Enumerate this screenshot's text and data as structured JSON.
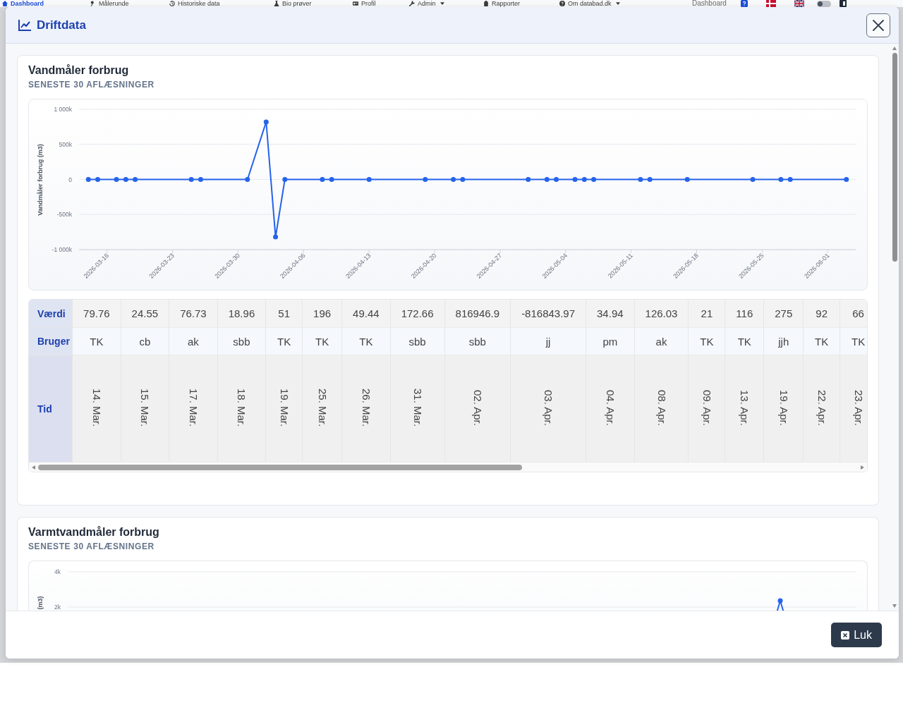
{
  "background_nav": {
    "items": [
      {
        "label": "Dashboard",
        "selected": true,
        "has_menu": false
      },
      {
        "label": "Målerunde",
        "selected": false,
        "has_menu": false
      },
      {
        "label": "Historiske data",
        "selected": false,
        "has_menu": false
      },
      {
        "label": "Bio prøver",
        "selected": false,
        "has_menu": false
      },
      {
        "label": "Profil",
        "selected": false,
        "has_menu": false
      },
      {
        "label": "Admin",
        "selected": false,
        "has_menu": true
      },
      {
        "label": "Rapporter",
        "selected": false,
        "has_menu": false
      },
      {
        "label": "Om databad.dk",
        "selected": false,
        "has_menu": true
      }
    ],
    "page_title": "Dashboard",
    "theme_switch": {
      "on": false
    }
  },
  "dialog": {
    "title": "Driftdata",
    "sections": [
      {
        "title": "Vandmåler forbrug",
        "subtitle": "SENESTE 30 AFLÆSNINGER",
        "chart_data": {
          "type": "line",
          "ylabel": "Vandmåler forbrug (m3)",
          "x": [
            "2026-03-14",
            "2026-03-15",
            "2026-03-17",
            "2026-03-18",
            "2026-03-19",
            "2026-03-25",
            "2026-03-26",
            "2026-03-31",
            "2026-04-02",
            "2026-04-03",
            "2026-04-04",
            "2026-04-08",
            "2026-04-09",
            "2026-04-13",
            "2026-04-19",
            "2026-04-22",
            "2026-04-23",
            "2026-04-30",
            "2026-05-02",
            "2026-05-03",
            "2026-05-05",
            "2026-05-06",
            "2026-05-07",
            "2026-05-12",
            "2026-05-13",
            "2026-05-17",
            "2026-05-24",
            "2026-05-27",
            "2026-05-28",
            "2026-06-03"
          ],
          "series": [
            {
              "color": "#2563eb",
              "marker": true,
              "values": [
                0,
                0,
                0,
                0,
                0,
                0,
                0,
                0,
                820000,
                -820000,
                0,
                0,
                0,
                0,
                0,
                0,
                0,
                0,
                0,
                0,
                0,
                0,
                0,
                0,
                0,
                0,
                0,
                0,
                0,
                0
              ]
            }
          ],
          "xlim": [
            "2026-03-13",
            "2026-06-04"
          ],
          "ylim": [
            -1000000,
            1000000
          ],
          "xticks": [
            "2026-03-16",
            "2026-03-23",
            "2026-03-30",
            "2026-04-06",
            "2026-04-13",
            "2026-04-20",
            "2026-04-27",
            "2026-05-04",
            "2026-05-11",
            "2026-05-18",
            "2026-05-25",
            "2026-06-01"
          ],
          "yticks": [
            {
              "value": 1000000,
              "label": "1 000k"
            },
            {
              "value": 500000,
              "label": "500k"
            },
            {
              "value": 0,
              "label": "0"
            },
            {
              "value": -500000,
              "label": "-500k"
            },
            {
              "value": -1000000,
              "label": "-1 000k"
            }
          ],
          "grid": true
        },
        "table": {
          "row_headers": [
            "Værdi",
            "Bruger",
            "Tid"
          ],
          "columns": [
            {
              "value": "79.76",
              "user": "TK",
              "time": "14. Mar."
            },
            {
              "value": "24.55",
              "user": "cb",
              "time": "15. Mar."
            },
            {
              "value": "76.73",
              "user": "ak",
              "time": "17. Mar."
            },
            {
              "value": "18.96",
              "user": "sbb",
              "time": "18. Mar."
            },
            {
              "value": "51",
              "user": "TK",
              "time": "19. Mar."
            },
            {
              "value": "196",
              "user": "TK",
              "time": "25. Mar."
            },
            {
              "value": "49.44",
              "user": "TK",
              "time": "26. Mar."
            },
            {
              "value": "172.66",
              "user": "sbb",
              "time": "31. Mar."
            },
            {
              "value": "816946.9",
              "user": "sbb",
              "time": "02. Apr."
            },
            {
              "value": "-816843.97",
              "user": "jj",
              "time": "03. Apr."
            },
            {
              "value": "34.94",
              "user": "pm",
              "time": "04. Apr."
            },
            {
              "value": "126.03",
              "user": "ak",
              "time": "08. Apr."
            },
            {
              "value": "21",
              "user": "TK",
              "time": "09. Apr."
            },
            {
              "value": "116",
              "user": "TK",
              "time": "13. Apr."
            },
            {
              "value": "275",
              "user": "jjh",
              "time": "19. Apr."
            },
            {
              "value": "92",
              "user": "TK",
              "time": "22. Apr."
            },
            {
              "value": "66",
              "user": "TK",
              "time": "23. Apr."
            }
          ]
        }
      },
      {
        "title": "Varmtvandmåler forbrug",
        "subtitle": "SENESTE 30 AFLÆSNINGER",
        "chart": {
          "ylabel": "(m3)",
          "ytick_labels": [
            "4k",
            "2k"
          ]
        }
      }
    ],
    "footer_button": "Luk"
  }
}
